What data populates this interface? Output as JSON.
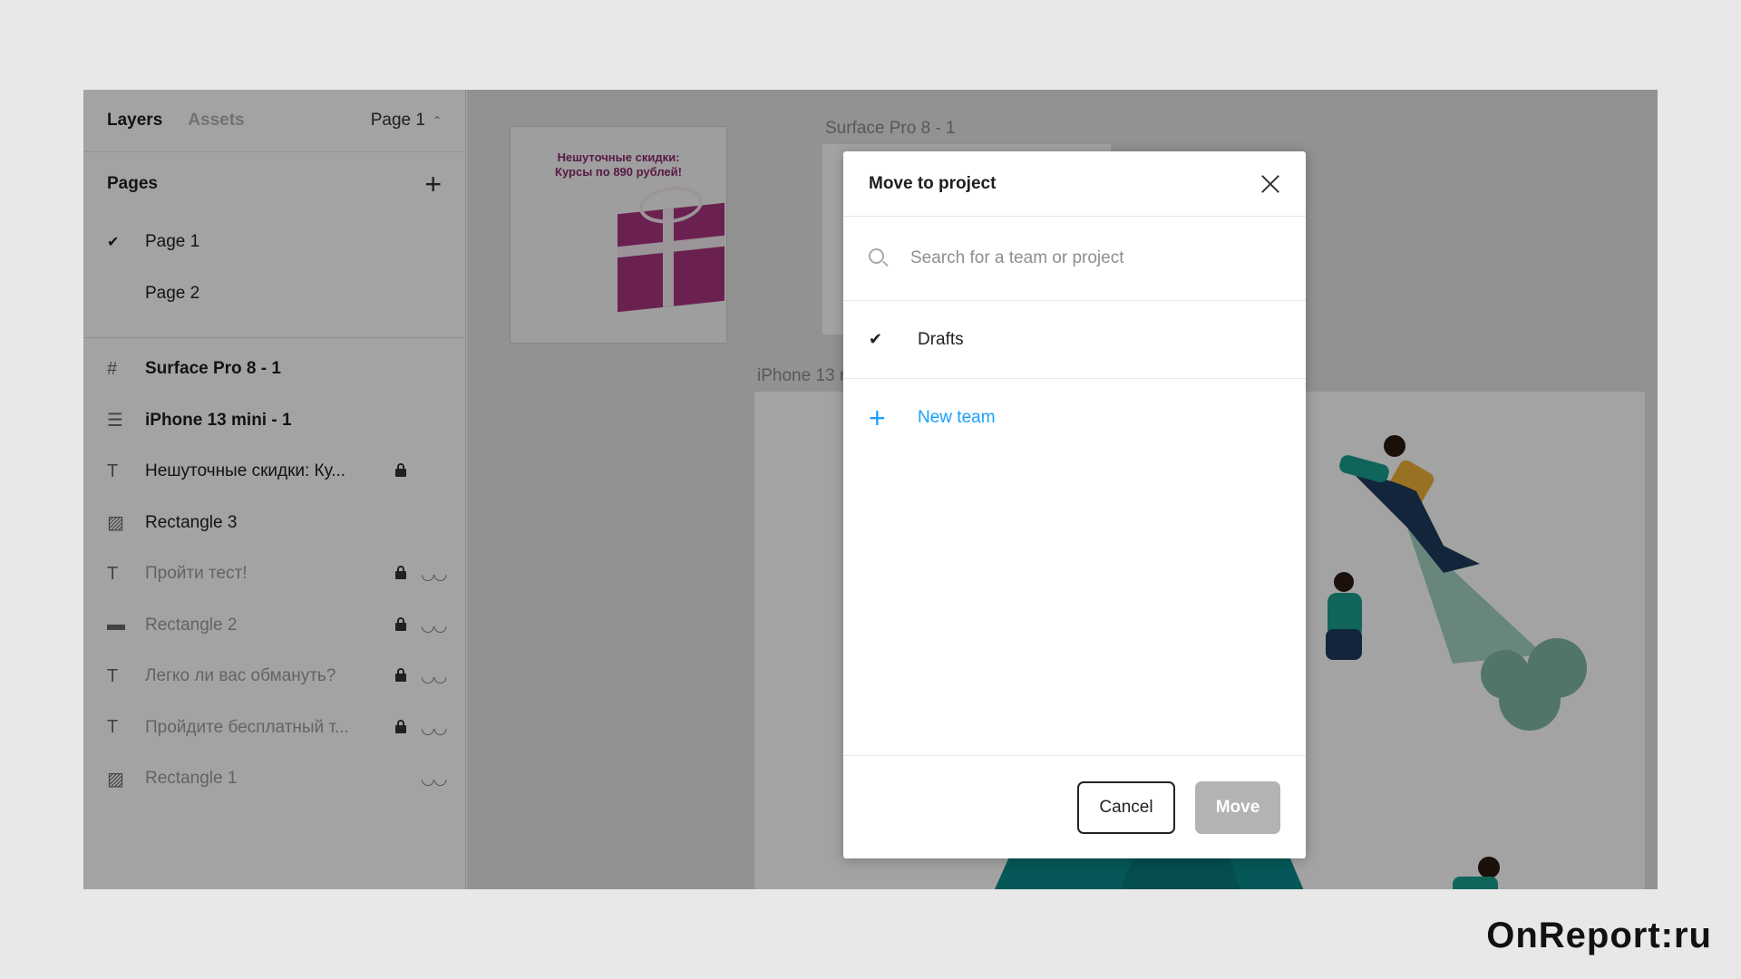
{
  "sidebar": {
    "tabs": [
      {
        "label": "Layers"
      },
      {
        "label": "Assets"
      }
    ],
    "page_select": "Page 1",
    "pages_title": "Pages",
    "pages": [
      {
        "label": "Page 1",
        "selected": true
      },
      {
        "label": "Page 2",
        "selected": false
      }
    ],
    "layers": [
      {
        "name": "Surface Pro 8 - 1",
        "icon": "frame-icon"
      },
      {
        "name": "iPhone 13 mini - 1",
        "icon": "component-icon"
      },
      {
        "name": "Нешуточные скидки: Ку...",
        "icon": "text-icon",
        "locked": true
      },
      {
        "name": "Rectangle 3",
        "icon": "image-icon"
      },
      {
        "name": "Пройти тест!",
        "icon": "text-icon",
        "locked": true,
        "hidden": true
      },
      {
        "name": "Rectangle 2",
        "icon": "rectangle-icon",
        "locked": true,
        "hidden": true
      },
      {
        "name": "Легко ли вас обмануть?",
        "icon": "text-icon",
        "locked": true,
        "hidden": true
      },
      {
        "name": "Пройдите бесплатный т...",
        "icon": "text-icon",
        "locked": true,
        "hidden": true
      },
      {
        "name": "Rectangle 1",
        "icon": "image-icon",
        "hidden": true
      }
    ]
  },
  "canvas": {
    "frame_surface_label": "Surface Pro 8 - 1",
    "frame_iphone_label": "iPhone 13 m",
    "promo_line1": "Нешуточные скидки:",
    "promo_line2": "Курсы по 890 рублей!"
  },
  "modal": {
    "title": "Move to project",
    "search_placeholder": "Search for a team or project",
    "option_selected": "Drafts",
    "new_team": "New team",
    "cancel_label": "Cancel",
    "move_label": "Move"
  },
  "watermark": "OnReport:ru",
  "colors": {
    "accent_blue": "#18a0fb",
    "teal": "#0a8a8a",
    "gift_purple": "#a8357e"
  }
}
